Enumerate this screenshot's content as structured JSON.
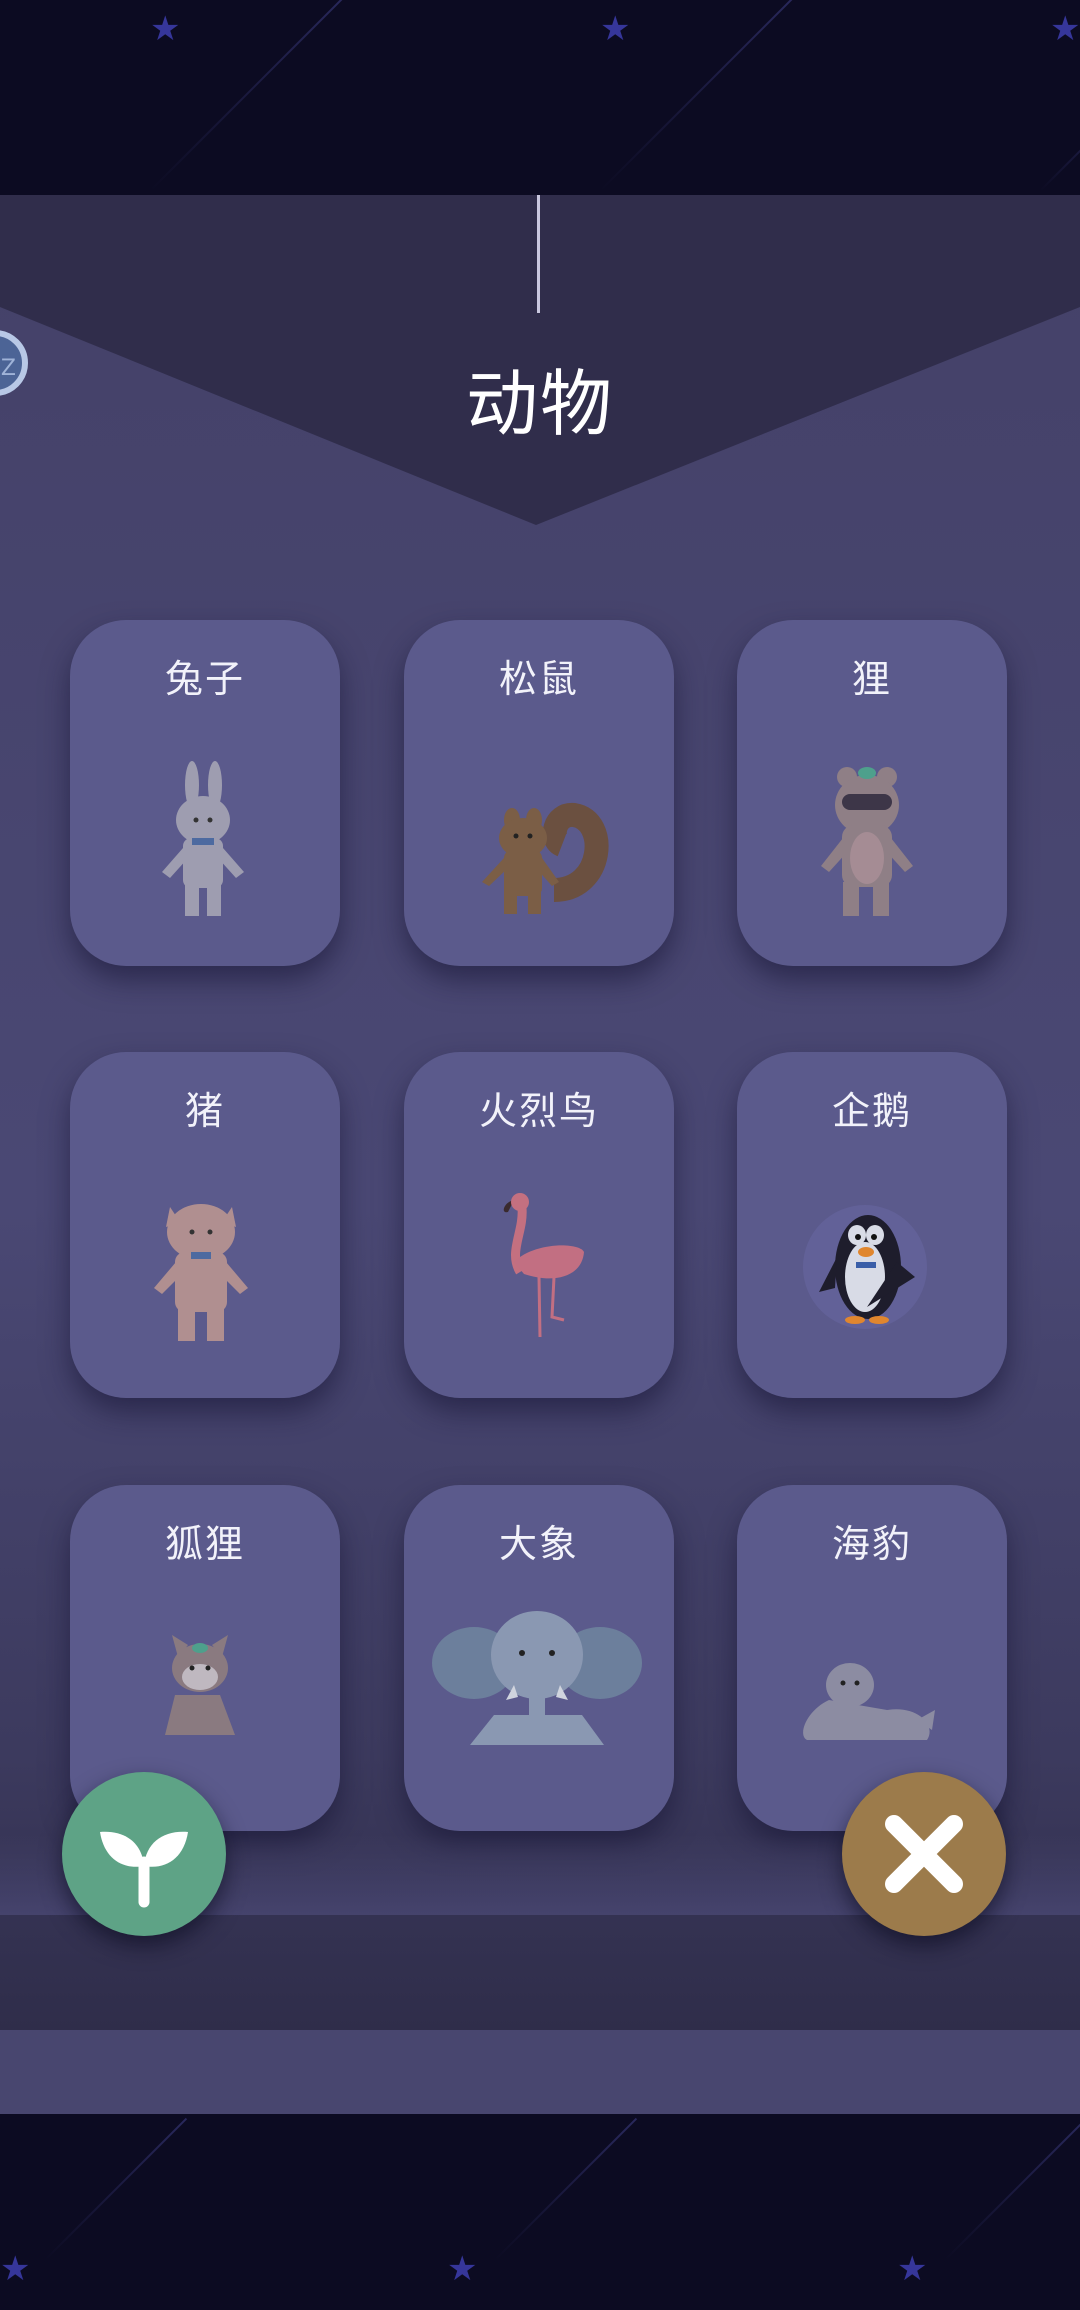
{
  "header": {
    "title": "动物"
  },
  "sleep_badge": {
    "text": "ZZ"
  },
  "animals": [
    {
      "label": "兔子",
      "icon": "rabbit-icon"
    },
    {
      "label": "松鼠",
      "icon": "squirrel-icon"
    },
    {
      "label": "狸",
      "icon": "raccoon-dog-icon"
    },
    {
      "label": "猪",
      "icon": "pig-icon"
    },
    {
      "label": "火烈鸟",
      "icon": "flamingo-icon"
    },
    {
      "label": "企鹅",
      "icon": "penguin-icon"
    },
    {
      "label": "狐狸",
      "icon": "fox-icon"
    },
    {
      "label": "大象",
      "icon": "elephant-icon"
    },
    {
      "label": "海豹",
      "icon": "seal-icon"
    }
  ],
  "buttons": {
    "left_icon": "sprout-icon",
    "right_icon": "close-icon"
  },
  "colors": {
    "panel": "#4a4874",
    "card": "#5b5a8c",
    "sprout_button": "#5ea386",
    "close_button": "#9c7b4b"
  }
}
